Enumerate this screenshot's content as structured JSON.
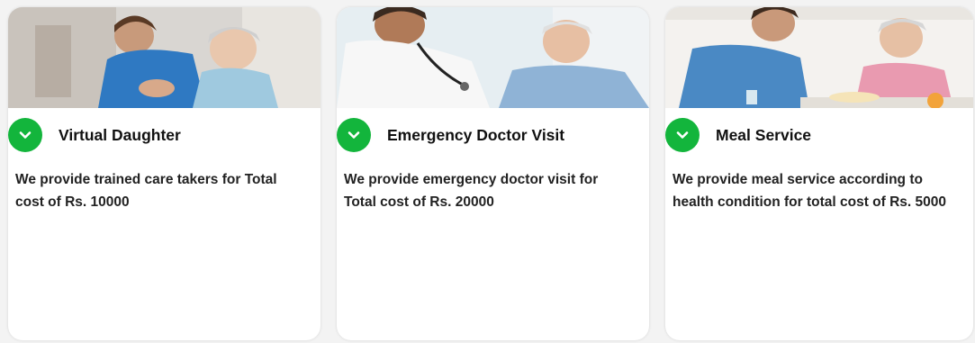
{
  "services": [
    {
      "title": "Virtual Daughter",
      "description": "We provide trained care takers for Total cost of Rs. 10000",
      "image_icon": "caregiver-hugging-elder-photo"
    },
    {
      "title": "Emergency Doctor Visit",
      "description": "We provide emergency doctor visit for Total cost of Rs. 20000",
      "image_icon": "doctor-stethoscope-elder-photo"
    },
    {
      "title": "Meal Service",
      "description": "We provide meal service according to health condition for total cost of Rs. 5000",
      "image_icon": "nurse-serving-meal-photo"
    }
  ],
  "colors": {
    "accent_green": "#13b53c",
    "card_background": "#ffffff",
    "page_background": "#f3f3f3",
    "scrub_blue": "#3a86c8"
  }
}
